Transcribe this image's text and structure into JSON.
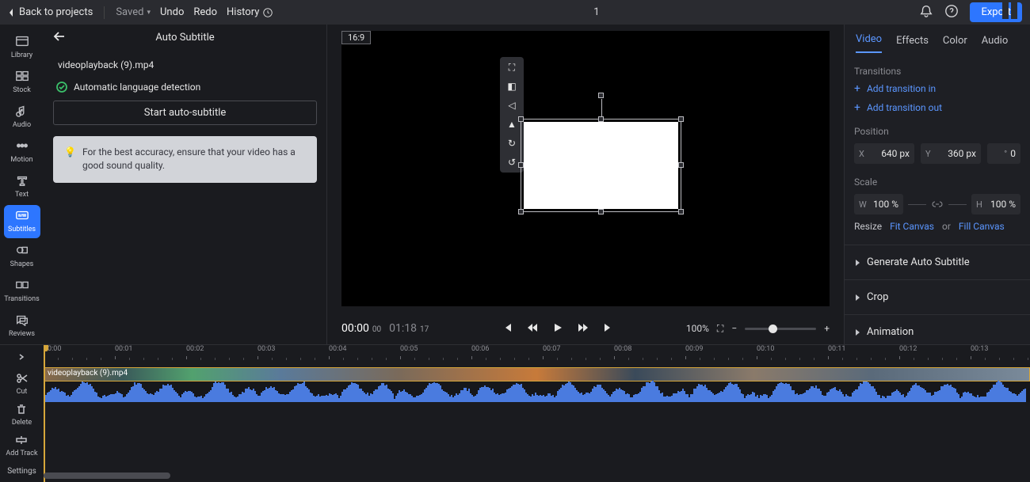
{
  "top": {
    "back": "Back to projects",
    "saved": "Saved",
    "undo": "Undo",
    "redo": "Redo",
    "history": "History",
    "title": "1",
    "export": "Export"
  },
  "tools": {
    "library": "Library",
    "stock": "Stock",
    "audio": "Audio",
    "motion": "Motion",
    "text": "Text",
    "subtitles": "Subtitles",
    "shapes": "Shapes",
    "transitions": "Transitions",
    "reviews": "Reviews"
  },
  "panel": {
    "title": "Auto Subtitle",
    "filename": "videoplayback (9).mp4",
    "autolang": "Automatic language detection",
    "start": "Start auto-subtitle",
    "tip": "For the best accuracy, ensure that your video has a good sound quality."
  },
  "preview": {
    "aspect": "16:9",
    "cur": "00:00",
    "cur_f": "00",
    "dur": "01:18",
    "dur_f": "17",
    "zoom": "100%",
    "fit": "100%"
  },
  "props": {
    "tabs": {
      "video": "Video",
      "effects": "Effects",
      "color": "Color",
      "audio": "Audio"
    },
    "transitions": "Transitions",
    "add_in": "Add transition in",
    "add_out": "Add transition out",
    "position": "Position",
    "x_lbl": "X",
    "x_val": "640 px",
    "y_lbl": "Y",
    "y_val": "360 px",
    "rot_lbl": "°",
    "rot_val": "0",
    "scale": "Scale",
    "w_lbl": "W",
    "w_val": "100 %",
    "h_lbl": "H",
    "h_val": "100 %",
    "resize": "Resize",
    "fit": "Fit Canvas",
    "or": "or",
    "fill": "Fill Canvas",
    "gen": "Generate Auto Subtitle",
    "crop": "Crop",
    "anim": "Animation"
  },
  "tl": {
    "cut": "Cut",
    "delete": "Delete",
    "add": "Add Track",
    "settings": "Settings",
    "clip": "videoplayback (9).mp4",
    "marks": [
      "00:00",
      "00:01",
      "00:02",
      "00:03",
      "00:04",
      "00:05",
      "00:06",
      "00:07",
      "00:08",
      "00:09",
      "00:10",
      "00:11",
      "00:12",
      "00:13"
    ]
  }
}
